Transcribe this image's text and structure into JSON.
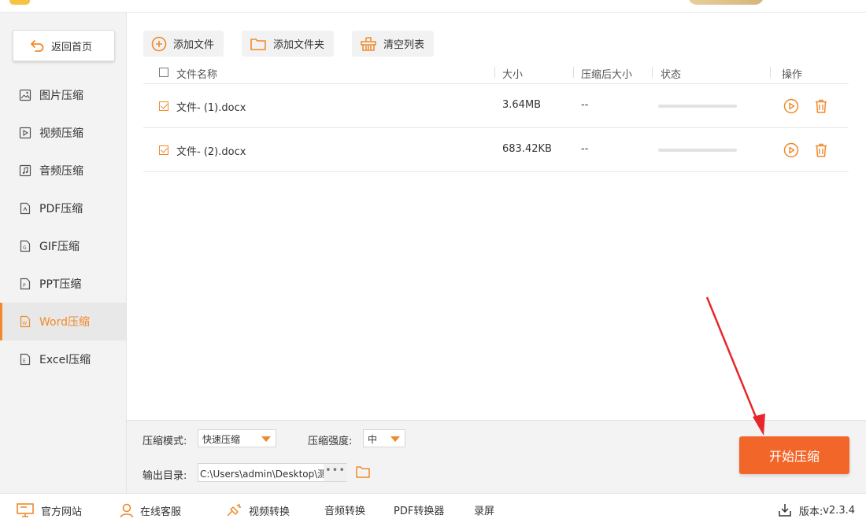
{
  "app": {
    "title_partial": ""
  },
  "sidebar": {
    "back_label": "返回首页",
    "items": [
      {
        "label": "图片压缩",
        "icon": "image-icon"
      },
      {
        "label": "视频压缩",
        "icon": "video-icon"
      },
      {
        "label": "音频压缩",
        "icon": "audio-icon"
      },
      {
        "label": "PDF压缩",
        "icon": "pdf-icon"
      },
      {
        "label": "GIF压缩",
        "icon": "gif-icon"
      },
      {
        "label": "PPT压缩",
        "icon": "ppt-icon"
      },
      {
        "label": "Word压缩",
        "icon": "word-icon",
        "active": true
      },
      {
        "label": "Excel压缩",
        "icon": "excel-icon"
      }
    ]
  },
  "toolbar": {
    "add_file": "添加文件",
    "add_folder": "添加文件夹",
    "clear_list": "清空列表"
  },
  "table": {
    "columns": [
      "文件名称",
      "大小",
      "压缩后大小",
      "状态",
      "操作"
    ],
    "rows": [
      {
        "checked": true,
        "name": "文件- (1).docx",
        "size": "3.64MB",
        "compressed_size": "--",
        "progress": 0
      },
      {
        "checked": true,
        "name": "文件- (2).docx",
        "size": "683.42KB",
        "compressed_size": "--",
        "progress": 0
      }
    ]
  },
  "settings": {
    "mode_label": "压缩模式:",
    "mode_value": "快速压缩",
    "strength_label": "压缩强度:",
    "strength_value": "中",
    "output_label": "输出目录:",
    "output_path": "C:\\Users\\admin\\Desktop\\测",
    "more_label": "•••",
    "start_label": "开始压缩"
  },
  "footer": {
    "website": "官方网站",
    "support": "在线客服",
    "video_convert": "视频转换",
    "audio_convert": "音频转换",
    "pdf_convert": "PDF转换器",
    "record": "录屏",
    "version_label": "版本:",
    "version_value": "v2.3.4"
  },
  "colors": {
    "accent": "#f0892a",
    "start_button": "#f2662a",
    "annotation": "#e8262b"
  }
}
